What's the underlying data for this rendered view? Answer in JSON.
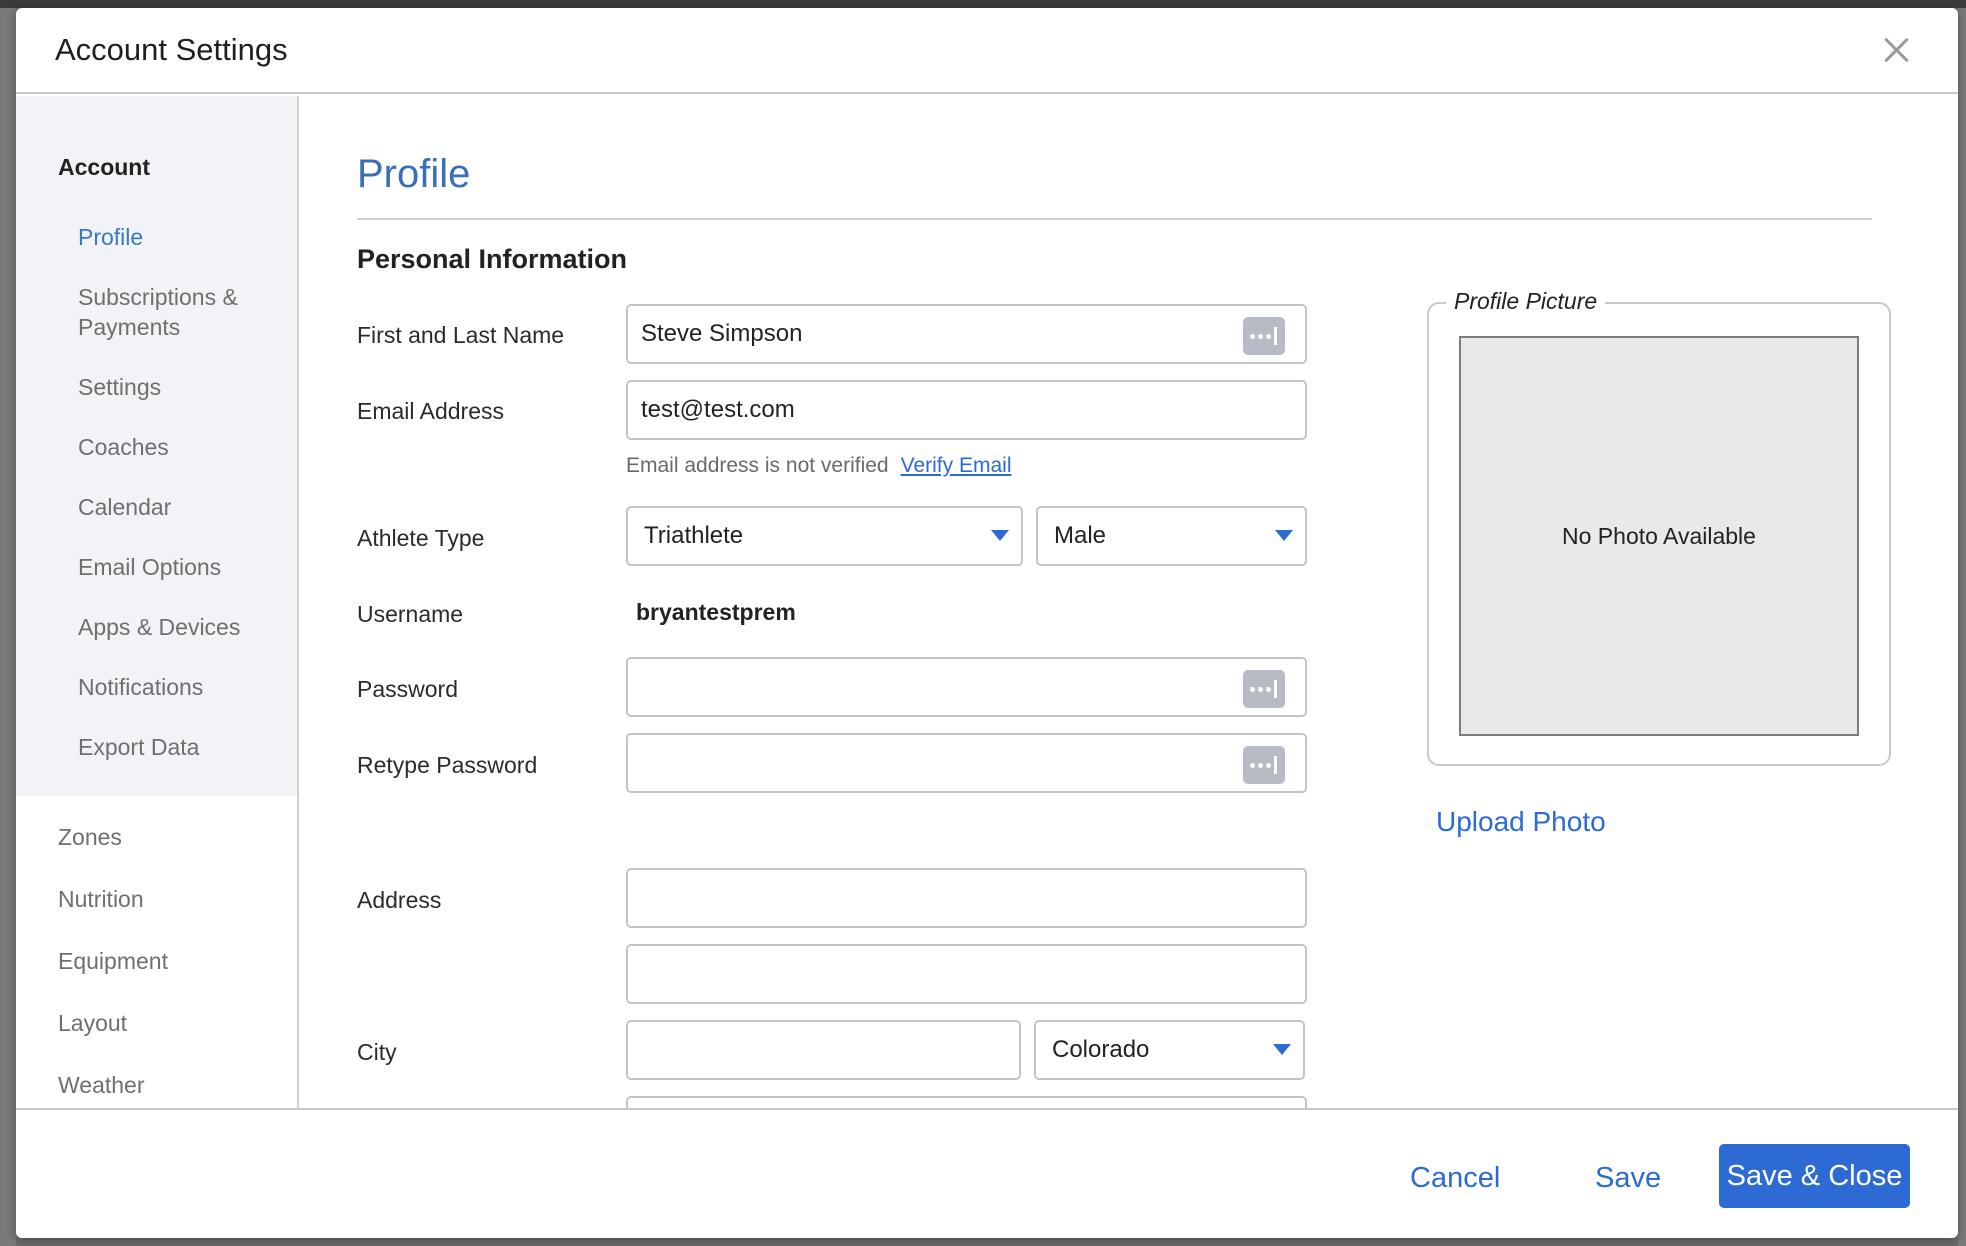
{
  "modal": {
    "title": "Account Settings"
  },
  "sidebar": {
    "account_heading": "Account",
    "account_items": [
      {
        "label": "Profile",
        "active": true
      },
      {
        "label": "Subscriptions & Payments"
      },
      {
        "label": "Settings"
      },
      {
        "label": "Coaches"
      },
      {
        "label": "Calendar"
      },
      {
        "label": "Email Options"
      },
      {
        "label": "Apps & Devices"
      },
      {
        "label": "Notifications"
      },
      {
        "label": "Export Data"
      }
    ],
    "sections": [
      {
        "label": "Zones"
      },
      {
        "label": "Nutrition"
      },
      {
        "label": "Equipment"
      },
      {
        "label": "Layout"
      },
      {
        "label": "Weather"
      }
    ]
  },
  "main": {
    "section_title": "Profile",
    "subsection_title": "Personal Information",
    "fields": {
      "name": {
        "label": "First and Last Name",
        "value": "Steve Simpson"
      },
      "email": {
        "label": "Email Address",
        "value": "test@test.com"
      },
      "email_hint": "Email address is not verified",
      "verify_link": "Verify Email",
      "athlete_type": {
        "label": "Athlete Type",
        "value": "Triathlete"
      },
      "gender": {
        "value": "Male"
      },
      "username": {
        "label": "Username",
        "value": "bryantestprem"
      },
      "password": {
        "label": "Password",
        "value": ""
      },
      "retype_password": {
        "label": "Retype Password",
        "value": ""
      },
      "address": {
        "label": "Address",
        "line1": "",
        "line2": ""
      },
      "city": {
        "label": "City",
        "value": ""
      },
      "state": {
        "value": "Colorado"
      }
    },
    "profile_picture": {
      "legend": "Profile Picture",
      "placeholder": "No Photo Available",
      "upload_label": "Upload Photo"
    }
  },
  "footer": {
    "cancel_label": "Cancel",
    "save_label": "Save",
    "save_close_label": "Save & Close"
  },
  "colors": {
    "accent": "#2e6ad3",
    "title_blue": "#3a6fb5",
    "sidebar_bg": "#f1f3f6"
  }
}
